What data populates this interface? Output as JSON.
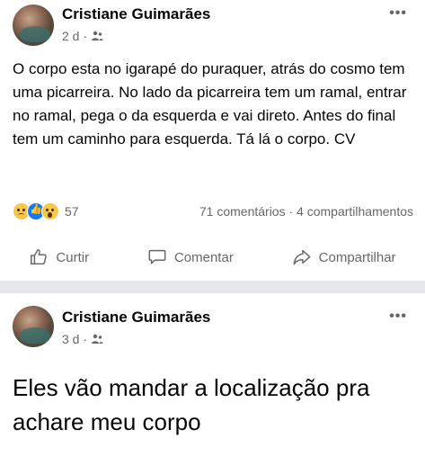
{
  "post1": {
    "author": "Cristiane Guimarães",
    "time": "2 d",
    "meta_separator": "·",
    "privacy_icon": "friends-icon",
    "body": "O corpo esta no igarapé do puraquer, atrás do cosmo tem uma picarreira. No lado da picarreira tem um ramal, entrar no ramal, pega o da esquerda e vai direto.  Antes do final tem um caminho para esquerda. Tá lá o corpo. CV",
    "reaction_icons": [
      "sad-reaction-icon",
      "like-reaction-icon",
      "wow-reaction-icon"
    ],
    "reaction_count": "57",
    "comments": "71 comentários",
    "stats_separator": "·",
    "shares": "4 compartilhamentos",
    "actions": {
      "like": "Curtir",
      "comment": "Comentar",
      "share": "Compartilhar"
    }
  },
  "post2": {
    "author": "Cristiane Guimarães",
    "time": "3 d",
    "meta_separator": "·",
    "privacy_icon": "friends-icon",
    "body": "Eles vão mandar a localização pra achare meu corpo"
  },
  "colors": {
    "text": "#050505",
    "secondary": "#65676b",
    "divider": "#e4e6eb",
    "like_blue": "#1877f2",
    "reaction_yellow": "#f7c64a"
  }
}
